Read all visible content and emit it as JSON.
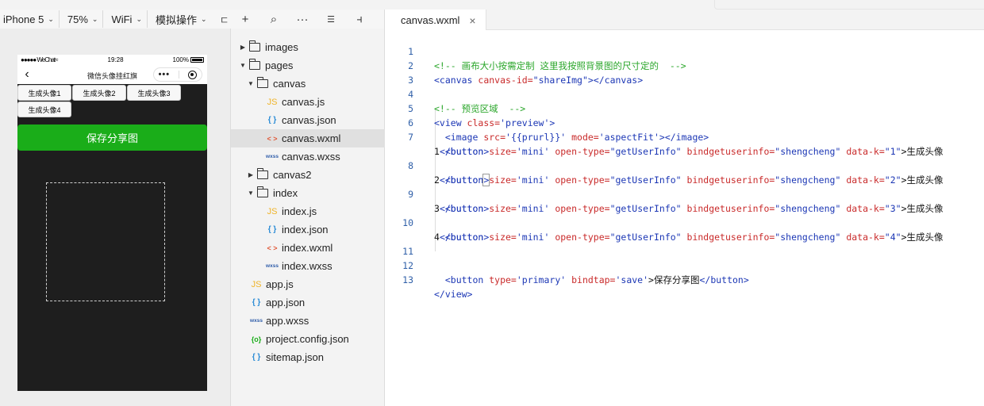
{
  "toolbar": {
    "device": "iPhone 5",
    "zoom": "75%",
    "network": "WiFi",
    "operation": "模拟操作",
    "cut_glyph": "ㄷ"
  },
  "tree_toolbar": {
    "add": "+",
    "search": "⌕",
    "more": "···",
    "sort": "☰",
    "collapse": "⫞"
  },
  "simulator": {
    "status": {
      "carrier": "●●●●● WeChat",
      "wifi": "≈",
      "time": "19:28",
      "battery": "100%"
    },
    "nav_title": "微信头像挂红旗",
    "buttons": [
      "生成头像1",
      "生成头像2",
      "生成头像3",
      "生成头像4"
    ],
    "save_label": "保存分享图"
  },
  "tree": {
    "images": "images",
    "pages": "pages",
    "canvas": "canvas",
    "canvas_js": "canvas.js",
    "canvas_json": "canvas.json",
    "canvas_wxml": "canvas.wxml",
    "canvas_wxss": "canvas.wxss",
    "canvas2": "canvas2",
    "index": "index",
    "index_js": "index.js",
    "index_json": "index.json",
    "index_wxml": "index.wxml",
    "index_wxss": "index.wxss",
    "app_js": "app.js",
    "app_json": "app.json",
    "app_wxss": "app.wxss",
    "project_config": "project.config.json",
    "sitemap": "sitemap.json",
    "icons": {
      "js": "JS",
      "json": "{ }",
      "wxml": "< >",
      "wxss": "wxss",
      "cfg": "{o}"
    }
  },
  "editor": {
    "tab_label": "canvas.wxml",
    "tab_close": "×",
    "line_numbers": [
      "1",
      "2",
      "3",
      "4",
      "5",
      "6",
      "7",
      "",
      "8",
      "",
      "9",
      "",
      "10",
      "",
      "11",
      "12",
      "13"
    ],
    "lines": {
      "l1_comment": "<!-- 画布大小按需定制 这里我按照背景图的尺寸定的  -->",
      "l2_open": "<canvas",
      "l2_attr": " canvas-id=",
      "l2_val": "\"shareImg\"",
      "l2_close": "></canvas>",
      "l4_comment": "<!-- 预览区域  -->",
      "l5_open": "<view",
      "l5_attr": " class=",
      "l5_val": "'preview'",
      "l5_close": ">",
      "l6_open": "  <image",
      "l6_attr1": " src=",
      "l6_val1": "'{{prurl}}'",
      "l6_attr2": " mode=",
      "l6_val2": "'aspectFit'",
      "l6_close": "></image>",
      "btn_open": "  <button",
      "btn_size_attr": " size=",
      "btn_size_val": "'mini'",
      "btn_type_attr": " open-type=",
      "btn_type_val": "\"getUserInfo\"",
      "btn_bind_attr": " bindgetuserinfo=",
      "btn_bind_val": "\"shengcheng\"",
      "btn_k_attr": " data-k=",
      "k1": "\"1\"",
      "k2": "\"2\"",
      "k3": "\"3\"",
      "k4": "\"4\"",
      "btn_text": ">生成头像",
      "n1": "1",
      "n2": "2",
      "n3": "3",
      "n4": "4",
      "btn_end": "</button>",
      "btn_end_open": "</button",
      "btn_end_gt": ">",
      "l12_open": "  <button",
      "l12_attr1": " type=",
      "l12_val1": "'primary'",
      "l12_attr2": " bindtap=",
      "l12_val2": "'save'",
      "l12_text": ">保存分享图",
      "l12_close": "</button>",
      "l13": "</view>"
    }
  }
}
